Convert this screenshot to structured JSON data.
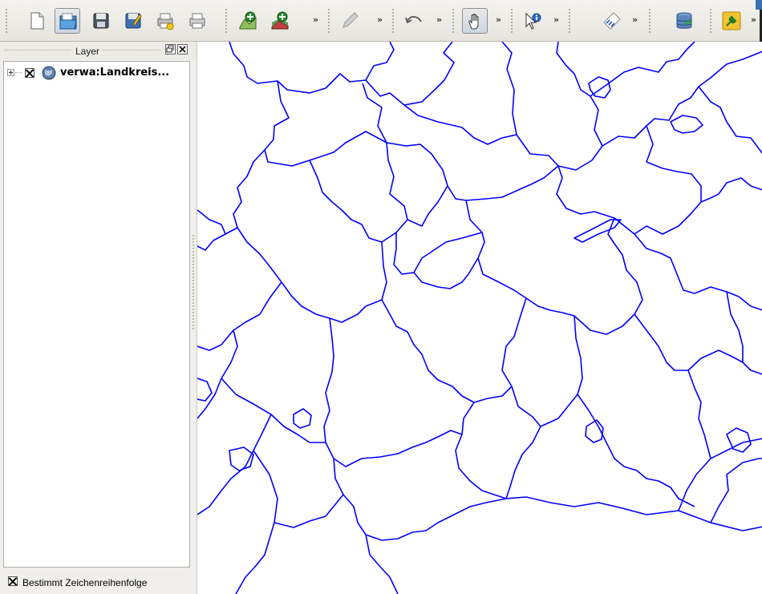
{
  "toolbar": {
    "more_glyph": "»",
    "buttons": [
      {
        "name": "new-project",
        "icon": "new-document-icon"
      },
      {
        "name": "open-project",
        "icon": "open-folder-icon",
        "active": true
      },
      {
        "name": "save-project",
        "icon": "save-icon"
      },
      {
        "name": "save-project-as",
        "icon": "save-as-icon"
      },
      {
        "name": "new-print-composer",
        "icon": "print-composer-icon"
      },
      {
        "name": "print",
        "icon": "printer-icon"
      },
      {
        "name": "add-vector-layer",
        "icon": "add-vector-layer-icon"
      },
      {
        "name": "add-raster-layer",
        "icon": "add-raster-layer-icon"
      },
      {
        "name": "digitize",
        "icon": "pencil-icon"
      },
      {
        "name": "undo",
        "icon": "undo-icon"
      },
      {
        "name": "pan-map",
        "icon": "pan-hand-icon",
        "active": true
      },
      {
        "name": "identify-features",
        "icon": "identify-icon"
      },
      {
        "name": "labeling",
        "icon": "abc-label-icon"
      },
      {
        "name": "database",
        "icon": "database-icon"
      },
      {
        "name": "plugins",
        "icon": "plugin-icon"
      }
    ]
  },
  "layer_panel": {
    "title": "Layer",
    "layers": [
      {
        "label": "verwa:Landkreis...",
        "visible": true,
        "icon": "wms-layer-icon"
      }
    ],
    "draw_order_label": "Bestimmt Zeichenreihenfolge",
    "draw_order_checked": true
  },
  "map": {
    "stroke_color": "#0000ff",
    "background": "#ffffff"
  }
}
